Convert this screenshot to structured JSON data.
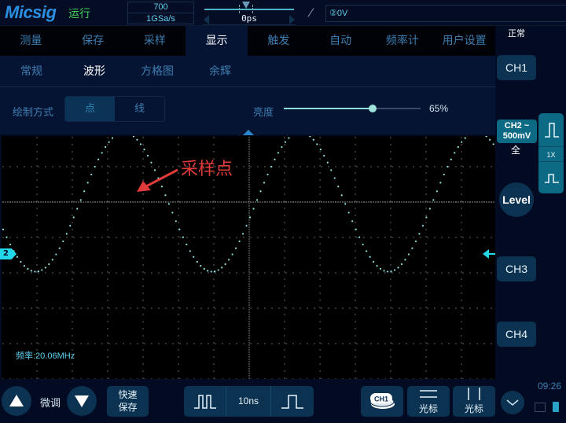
{
  "top_bar": {
    "logo": "Micsig",
    "run_status": "运行",
    "memory_depth": "700",
    "sample_rate": "1GSa/s",
    "horizontal_offset": "0ps",
    "trigger_slope_icon": "rising-edge-icon",
    "trigger_level": "②0V"
  },
  "menu": {
    "main_tabs": [
      {
        "label": "测量",
        "active": false
      },
      {
        "label": "保存",
        "active": false
      },
      {
        "label": "采样",
        "active": false
      },
      {
        "label": "显示",
        "active": true
      },
      {
        "label": "触发",
        "active": false
      },
      {
        "label": "自动",
        "active": false
      },
      {
        "label": "频率计",
        "active": false
      },
      {
        "label": "用户设置",
        "active": false
      }
    ],
    "sub_tabs": [
      {
        "label": "常规",
        "active": false
      },
      {
        "label": "波形",
        "active": true
      },
      {
        "label": "方格图",
        "active": false
      },
      {
        "label": "余辉",
        "active": false
      }
    ],
    "draw_mode": {
      "label": "绘制方式",
      "options": [
        "点",
        "线"
      ],
      "selected": "点"
    },
    "brightness": {
      "label": "亮度",
      "value_percent": 65,
      "display": "65%"
    }
  },
  "scope": {
    "annotation": "采样点",
    "annotation_color": "#e03a3a",
    "frequency_readout": "频率:20.06MHz",
    "channel_marker": "2",
    "trace_color": "#8fe6e0",
    "marker_color": "#22d8e8",
    "waveform": {
      "type": "sine",
      "frequency_mhz": 20.06,
      "timebase_per_div": "10ns",
      "horizontal_divisions": 14,
      "vertical_divisions": 7,
      "volts_per_div": "500mV",
      "amplitude_div": 1.97,
      "offset_div": 1.47,
      "phase_deg": 200,
      "render_mode": "dots"
    }
  },
  "right_panel": {
    "acq_mode": "正常",
    "ch1": "CH1",
    "ch2_line1": "CH2 ~",
    "ch2_line2": "500mV",
    "ch2_coupling": "全",
    "probe": "1X",
    "level": "Level",
    "ch3": "CH3",
    "ch4": "CH4",
    "clock": "09:26"
  },
  "bottom_bar": {
    "fine_label": "微调",
    "quick_save_line1": "快速",
    "quick_save_line2": "保存",
    "timebase": "10ns",
    "ch1_select": "CH1",
    "hcursor_label": "光标",
    "vcursor_label": "光标"
  }
}
